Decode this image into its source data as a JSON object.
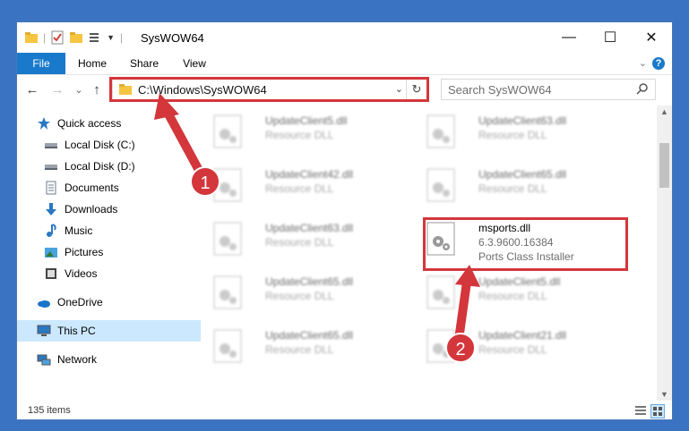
{
  "window": {
    "title": "SysWOW64"
  },
  "title_buttons": {
    "minimize": "—",
    "maximize": "☐",
    "close": "✕"
  },
  "ribbon": {
    "tabs": [
      {
        "label": "File"
      },
      {
        "label": "Home"
      },
      {
        "label": "Share"
      },
      {
        "label": "View"
      }
    ]
  },
  "nav": {
    "back": "←",
    "forward": "→",
    "recent": "⌄",
    "up": "↑",
    "address": "C:\\Windows\\SysWOW64",
    "search_placeholder": "Search SysWOW64"
  },
  "sidebar": {
    "items": [
      {
        "label": "Quick access",
        "icon": "star-icon"
      },
      {
        "label": "Local Disk (C:)",
        "icon": "drive-icon",
        "pinned": true
      },
      {
        "label": "Local Disk (D:)",
        "icon": "drive-icon",
        "pinned": true
      },
      {
        "label": "Documents",
        "icon": "documents-icon",
        "pinned": true
      },
      {
        "label": "Downloads",
        "icon": "download-icon",
        "pinned": true
      },
      {
        "label": "Music",
        "icon": "music-icon",
        "pinned": true
      },
      {
        "label": "Pictures",
        "icon": "pictures-icon",
        "pinned": true
      },
      {
        "label": "Videos",
        "icon": "videos-icon",
        "pinned": true
      },
      {
        "label": "OneDrive",
        "icon": "onedrive-icon"
      },
      {
        "label": "This PC",
        "icon": "pc-icon",
        "selected": true
      },
      {
        "label": "Network",
        "icon": "network-icon"
      }
    ]
  },
  "files": [
    {
      "name": "UpdateClient5.dll",
      "desc": "Resource DLL"
    },
    {
      "name": "UpdateClient63.dll",
      "desc": "Resource DLL"
    },
    {
      "name": "UpdateClient42.dll",
      "desc": "Resource DLL"
    },
    {
      "name": "UpdateClient65.dll",
      "desc": "Resource DLL"
    },
    {
      "name": "UpdateClient63.dll",
      "desc": "Resource DLL"
    },
    {
      "name": "msports.dll",
      "version": "6.3.9600.16384",
      "desc": "Ports Class Installer"
    },
    {
      "name": "UpdateClient65.dll",
      "desc": "Resource DLL"
    },
    {
      "name": "UpdateClient5.dll",
      "desc": "Resource DLL"
    },
    {
      "name": "UpdateClient65.dll",
      "desc": "Resource DLL"
    },
    {
      "name": "UpdateClient21.dll",
      "desc": "Resource DLL"
    }
  ],
  "status": {
    "count": "135 items"
  },
  "annotations": {
    "step1": "1",
    "step2": "2",
    "color": "#d3363b"
  }
}
